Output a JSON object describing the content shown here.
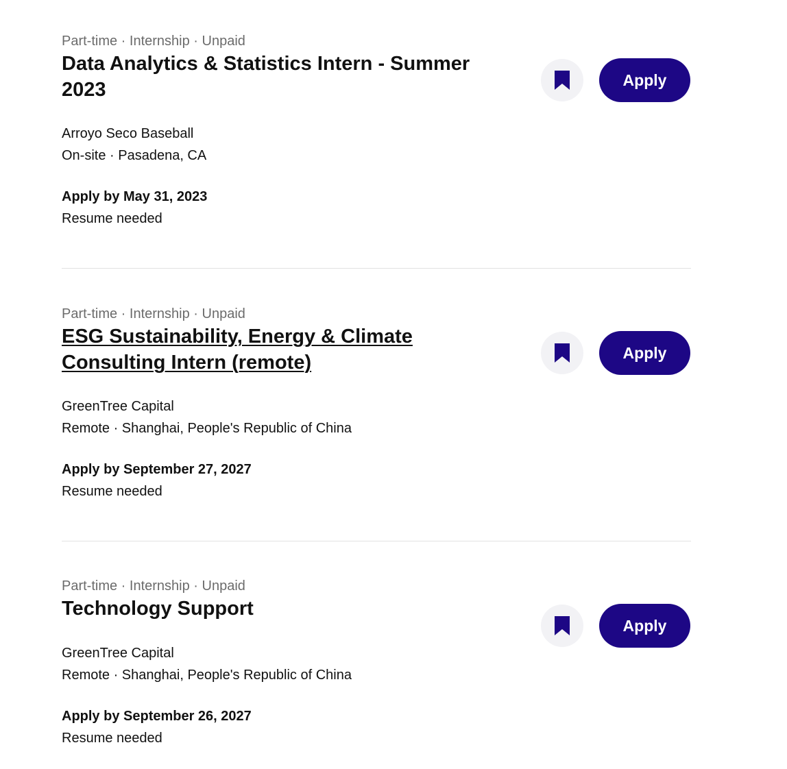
{
  "colors": {
    "accent": "#1d0785",
    "meta_text": "#6b6b6b",
    "bookmark_bg": "#f2f2f5",
    "divider": "#e2e2e2"
  },
  "jobs": [
    {
      "meta": "Part-time · Internship · Unpaid",
      "title": "Data Analytics & Statistics Intern - Summer 2023",
      "company": "Arroyo Seco Baseball",
      "location": "On-site · Pasadena, CA",
      "deadline": "Apply by May 31, 2023",
      "resume": "Resume needed",
      "apply_label": "Apply",
      "bookmark_icon": "bookmark-icon"
    },
    {
      "meta": "Part-time · Internship · Unpaid",
      "title": "ESG Sustainability, Energy & Climate Consulting Intern (remote)",
      "company": "GreenTree Capital",
      "location": "Remote · Shanghai, People's Republic of China",
      "deadline": "Apply by September 27, 2027",
      "resume": "Resume needed",
      "apply_label": "Apply",
      "bookmark_icon": "bookmark-icon"
    },
    {
      "meta": "Part-time · Internship · Unpaid",
      "title": "Technology Support",
      "company": "GreenTree Capital",
      "location": "Remote · Shanghai, People's Republic of China",
      "deadline": "Apply by September 26, 2027",
      "resume": "Resume needed",
      "apply_label": "Apply",
      "bookmark_icon": "bookmark-icon"
    }
  ]
}
